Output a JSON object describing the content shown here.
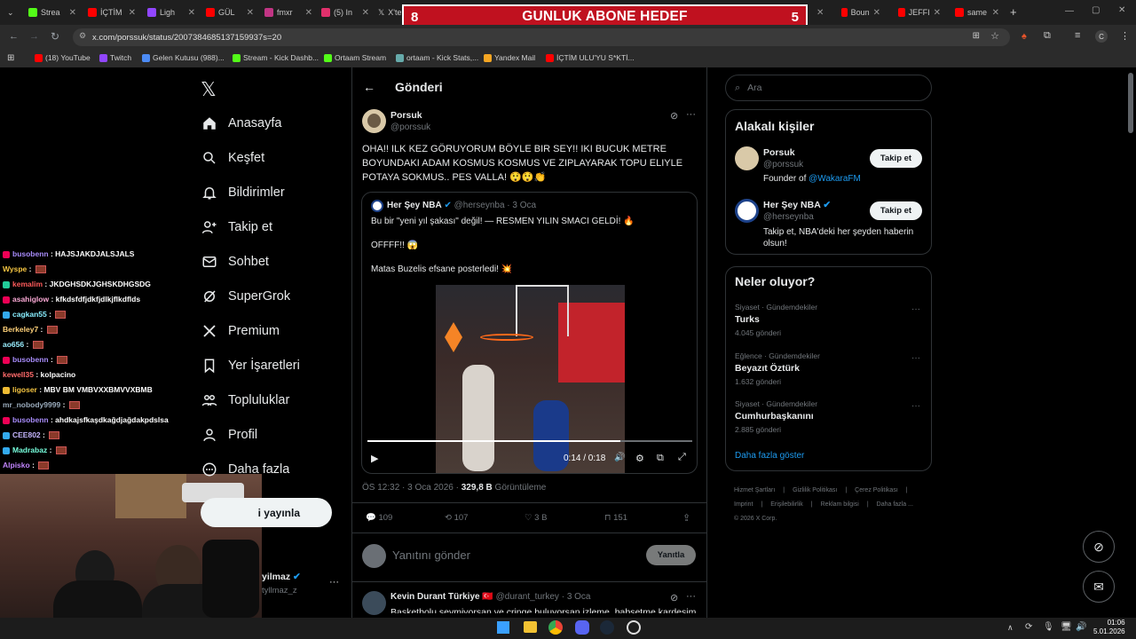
{
  "browser": {
    "tabs": [
      "Strea",
      "İÇTİM",
      "Ligh",
      "GÜL",
      "fmxr",
      "(5) In",
      "X'te",
      "Boun",
      "JEFFI",
      "same"
    ],
    "url": "x.com/porssuk/status/2007384685137159937s=20",
    "bookmarks": [
      "(18) YouTube",
      "Twitch",
      "Gelen Kutusu (988)...",
      "Stream - Kick Dashb...",
      "Ortaam Stream",
      "ortaam - Kick Stats,...",
      "Yandex Mail",
      "İÇTİM ULU'YU S*KTİ..."
    ]
  },
  "overlay": {
    "left": "8",
    "title": "GUNLUK ABONE HEDEF",
    "right": "5"
  },
  "chat": [
    {
      "user": "busobenn",
      "msg": "HAJSJAKDJALSJALS",
      "color": "#a78bfa",
      "icon": "#e05"
    },
    {
      "user": "Wyspe",
      "msg": "",
      "color": "#f5c542",
      "icon": ""
    },
    {
      "user": "kemalim",
      "msg": "JKDGHSDKJGHSKDHGSDG",
      "color": "#ff5b5b",
      "icon": "#2c9"
    },
    {
      "user": "asahiglow",
      "msg": "kfkdsfdfjdkfjdlkjflkdflds",
      "color": "#f9a8d4",
      "icon": "#e05"
    },
    {
      "user": "cagkan55",
      "msg": "",
      "color": "#8ef",
      "icon": "#3ae"
    },
    {
      "user": "Berkeley7",
      "msg": "",
      "color": "#ffd27a",
      "icon": ""
    },
    {
      "user": "ao656",
      "msg": "",
      "color": "#9ef",
      "icon": ""
    },
    {
      "user": "busobenn",
      "msg": "",
      "color": "#a78bfa",
      "icon": "#e05"
    },
    {
      "user": "kewell35",
      "msg": "kolpacino",
      "color": "#ff6b6b",
      "icon": ""
    },
    {
      "user": "ligoser",
      "msg": "MBV BM VMBVXXBMVVXBMB",
      "color": "#f5c542",
      "icon": "#eb3"
    },
    {
      "user": "mr_nobody9999",
      "msg": "",
      "color": "#9ab",
      "icon": ""
    },
    {
      "user": "busobenn",
      "msg": "ahdkajsfkaşdkağdjağdakpdslsa",
      "color": "#a78bfa",
      "icon": "#e05"
    },
    {
      "user": "CEE802",
      "msg": "",
      "color": "#c4b5fd",
      "icon": "#3ae"
    },
    {
      "user": "Madrabaz",
      "msg": "",
      "color": "#7fd",
      "icon": "#3ae"
    },
    {
      "user": "Alpisko",
      "msg": "",
      "color": "#c084fc",
      "icon": ""
    }
  ],
  "nav": [
    "Anasayfa",
    "Keşfet",
    "Bildirimler",
    "Takip et",
    "Sohbet",
    "SuperGrok",
    "Premium",
    "Yer İşaretleri",
    "Topluluklar",
    "Profil",
    "Daha fazla"
  ],
  "post_button": "i yayınla",
  "account": {
    "name": "yilmaz",
    "handle": "tyllmaz_z"
  },
  "header": {
    "title": "Gönderi"
  },
  "tweet": {
    "name": "Porsuk",
    "handle": "@porssuk",
    "text": "OHA!! ILK KEZ GÖRUYORUM BÖYLE BIR SEY!! IKI BUCUK METRE BOYUNDAKI ADAM KOSMUS KOSMUS VE ZIPLAYARAK TOPU ELIYLE POTAYA SOKMUS.. PES VALLA! 😲😲👏",
    "quote": {
      "name": "Her Şey NBA",
      "handle": "@herseynba",
      "date": "3 Oca",
      "line1": "Bu bir \"yeni yıl şakası\" değil! — RESMEN YILIN SMACI GELDİ! 🔥",
      "line2": "OFFFF!! 😱",
      "line3": "Matas Buzelis efsane posterledi! 💥"
    },
    "video": {
      "time": "0:14 / 0:18",
      "progress": 0.78
    },
    "timestamp": "ÖS 12:32 · 3 Oca 2026 · ",
    "views": "329,8 B",
    "views_label": " Görüntüleme",
    "stats": {
      "replies": "109",
      "reposts": "107",
      "likes": "3 B",
      "bookmarks": "151"
    }
  },
  "reply": {
    "placeholder": "Yanıtını gönder",
    "button": "Yanıtla"
  },
  "next_tweet": {
    "name": "Kevin Durant Türkiye",
    "flag": "🇹🇷",
    "handle": "@durant_turkey",
    "date": "3 Oca",
    "text": "Basketbolu sevmiyorsan ve cringe buluyorsan izleme, babsetme kardesim"
  },
  "search": {
    "placeholder": "Ara"
  },
  "related": {
    "title": "Alakalı kişiler",
    "people": [
      {
        "name": "Porsuk",
        "handle": "@porssuk",
        "bio_prefix": "Founder of ",
        "bio_link": "@WakaraFM",
        "follow": "Takip et"
      },
      {
        "name": "Her Şey NBA",
        "handle": "@herseynba",
        "bio_prefix": "Takip et, NBA'deki her şeyden haberin olsun!",
        "bio_link": "",
        "follow": "Takip et"
      }
    ]
  },
  "trends": {
    "title": "Neler oluyor?",
    "items": [
      {
        "cat": "Siyaset · Gündemdekiler",
        "name": "Turks",
        "count": "4.045 gönderi"
      },
      {
        "cat": "Eğlence · Gündemdekiler",
        "name": "Beyazıt Öztürk",
        "count": "1.632 gönderi"
      },
      {
        "cat": "Siyaset · Gündemdekiler",
        "name": "Cumhurbaşkanını",
        "count": "2.885 gönderi"
      }
    ],
    "more": "Daha fazla göster"
  },
  "footer": [
    "Hizmet Şartları",
    "|",
    "Gizlilik Politikası",
    "|",
    "Çerez Politikası",
    "|",
    "Imprint",
    "|",
    "Erişilebilirlik",
    "|",
    "Reklam bilgisi",
    "|",
    "Daha fazla ...",
    "© 2026 X Corp."
  ],
  "clock": {
    "time": "01:06",
    "date": "5.01.2026"
  },
  "colors": {
    "accent": "#1d9bf0",
    "banner": "#c0111f"
  }
}
